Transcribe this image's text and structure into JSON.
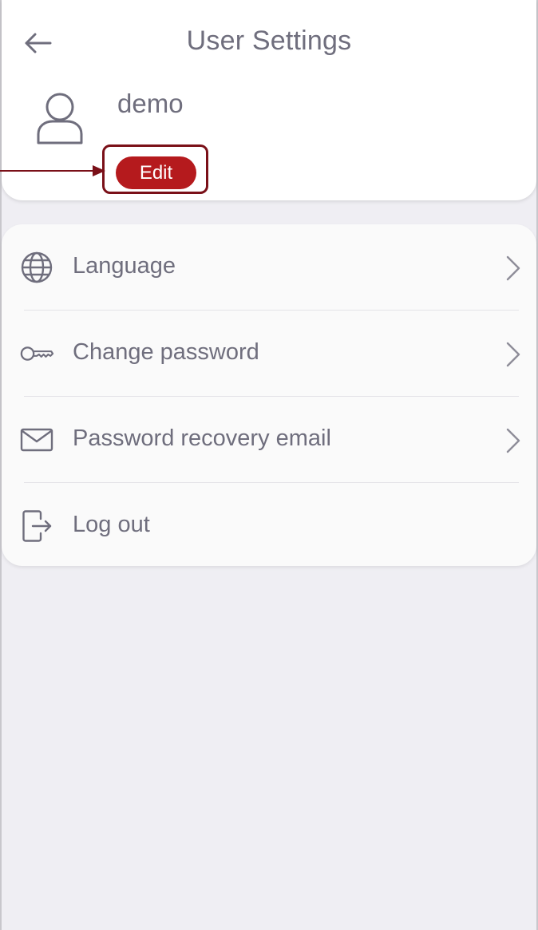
{
  "header": {
    "title": "User Settings",
    "back_icon": "arrow-left-icon"
  },
  "profile": {
    "avatar_icon": "user-icon",
    "username": "demo",
    "edit_label": "Edit"
  },
  "menu": {
    "items": [
      {
        "id": "language",
        "icon": "globe-icon",
        "label": "Language",
        "has_chevron": true
      },
      {
        "id": "change-password",
        "icon": "key-icon",
        "label": "Change password",
        "has_chevron": true
      },
      {
        "id": "password-recovery-email",
        "icon": "envelope-icon",
        "label": "Password recovery email",
        "has_chevron": true
      },
      {
        "id": "log-out",
        "icon": "logout-icon",
        "label": "Log out",
        "has_chevron": false
      }
    ]
  },
  "colors": {
    "accent": "#b51a1d",
    "highlight_border": "#7a1018",
    "text": "#6f6e7d",
    "background": "#efeef3",
    "card": "#ffffff"
  }
}
